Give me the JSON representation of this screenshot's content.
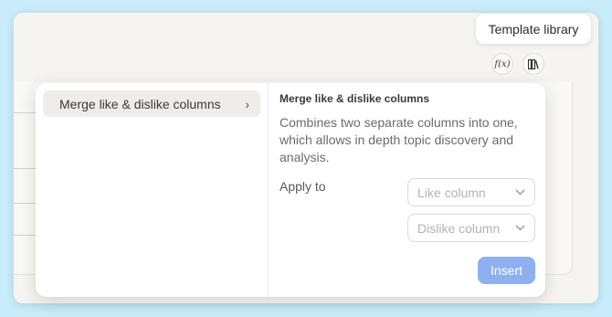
{
  "tooltip": {
    "text": "Template library"
  },
  "toolbar": {
    "formula_icon_text": "f(x)",
    "formula_icon": "function-icon",
    "library_icon": "library-icon"
  },
  "templates": [
    {
      "label": "Merge like & dislike columns",
      "selected": true
    }
  ],
  "detail": {
    "title": "Merge like & dislike columns",
    "description": "Combines two separate columns into one, which allows in depth topic discovery and analysis.",
    "apply_label": "Apply to",
    "like_placeholder": "Like column",
    "dislike_placeholder": "Dislike column",
    "insert_label": "Insert"
  },
  "colors": {
    "background": "#c9ecfa",
    "insert_button": "#8fb0ef",
    "selected_item": "#efedea"
  }
}
